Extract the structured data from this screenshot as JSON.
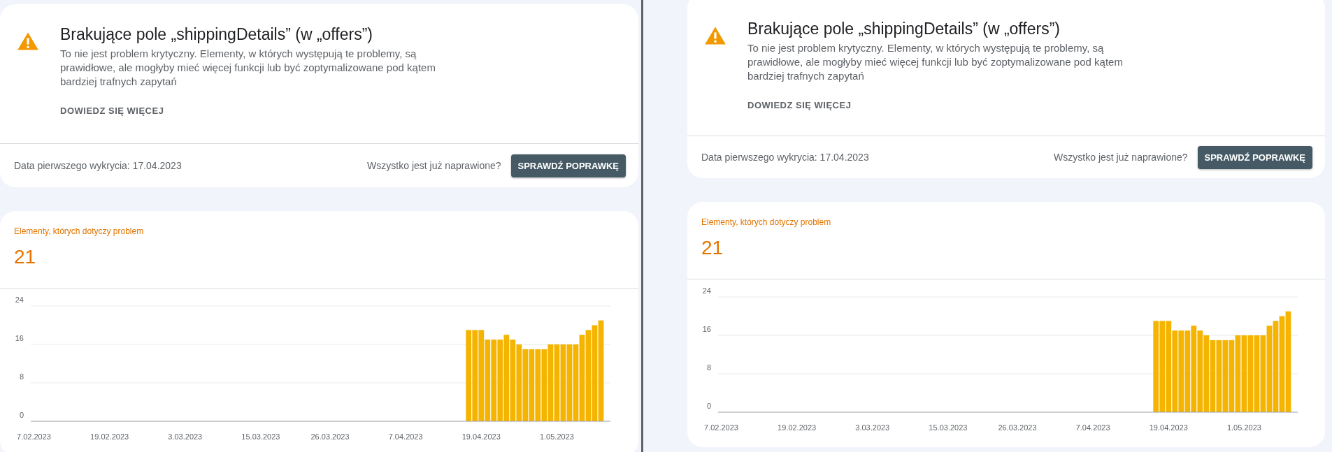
{
  "windows": [
    {
      "issue": {
        "title": "Brakujące pole „shippingDetails” (w „offers”)",
        "description": "To nie jest problem krytyczny. Elementy, w których występują te problemy, są prawidłowe, ale mogłyby mieć więcej funkcji lub być zoptymalizowane pod kątem bardziej trafnych zapytań",
        "learn_more": "DOWIEDZ SIĘ WIĘCEJ",
        "first_detected": "Data pierwszego wykrycia: 17.04.2023",
        "fixed_question": "Wszystko jest już naprawione?",
        "validate_button": "SPRAWDŹ POPRAWKĘ"
      },
      "affected": {
        "label": "Elementy, których dotyczy problem",
        "count": "21",
        "chart_data": {
          "type": "bar",
          "categories": [
            "7.02.2023",
            null,
            null,
            null,
            null,
            null,
            null,
            null,
            null,
            null,
            null,
            null,
            "19.02.2023",
            null,
            null,
            null,
            null,
            null,
            null,
            null,
            null,
            null,
            null,
            null,
            "3.03.2023",
            null,
            null,
            null,
            null,
            null,
            null,
            null,
            null,
            null,
            null,
            null,
            "15.03.2023",
            null,
            null,
            null,
            null,
            null,
            null,
            null,
            null,
            null,
            null,
            "26.03.2023",
            null,
            null,
            null,
            null,
            null,
            null,
            null,
            null,
            null,
            null,
            null,
            "7.04.2023",
            null,
            null,
            null,
            null,
            null,
            null,
            null,
            null,
            null,
            null,
            null,
            "19.04.2023",
            null,
            null,
            null,
            null,
            null,
            null,
            null,
            null,
            null,
            null,
            null,
            "1.05.2023",
            null,
            null,
            null,
            null,
            null,
            null,
            null,
            null
          ],
          "values": [
            null,
            null,
            null,
            null,
            null,
            null,
            null,
            null,
            null,
            null,
            null,
            null,
            null,
            null,
            null,
            null,
            null,
            null,
            null,
            null,
            null,
            null,
            null,
            null,
            null,
            null,
            null,
            null,
            null,
            null,
            null,
            null,
            null,
            null,
            null,
            null,
            null,
            null,
            null,
            null,
            null,
            null,
            null,
            null,
            null,
            null,
            null,
            null,
            null,
            null,
            null,
            null,
            null,
            null,
            null,
            null,
            null,
            null,
            null,
            null,
            null,
            null,
            null,
            null,
            null,
            null,
            null,
            null,
            null,
            19,
            19,
            19,
            17,
            17,
            17,
            18,
            17,
            16,
            15,
            15,
            15,
            15,
            16,
            16,
            16,
            16,
            16,
            18,
            19,
            20,
            21,
            null
          ],
          "ylim": [
            0,
            24
          ],
          "yticks": [
            0,
            8,
            16,
            24
          ]
        }
      }
    },
    {
      "issue": {
        "title": "Brakujące pole „shippingDetails” (w „offers”)",
        "description": "To nie jest problem krytyczny. Elementy, w których występują te problemy, są prawidłowe, ale mogłyby mieć więcej funkcji lub być zoptymalizowane pod kątem bardziej trafnych zapytań",
        "learn_more": "DOWIEDZ SIĘ WIĘCEJ",
        "first_detected": "Data pierwszego wykrycia: 17.04.2023",
        "fixed_question": "Wszystko jest już naprawione?",
        "validate_button": "SPRAWDŹ POPRAWKĘ"
      },
      "affected": {
        "label": "Elementy, których dotyczy problem",
        "count": "21",
        "chart_data": {
          "type": "bar",
          "categories": [
            "7.02.2023",
            null,
            null,
            null,
            null,
            null,
            null,
            null,
            null,
            null,
            null,
            null,
            "19.02.2023",
            null,
            null,
            null,
            null,
            null,
            null,
            null,
            null,
            null,
            null,
            null,
            "3.03.2023",
            null,
            null,
            null,
            null,
            null,
            null,
            null,
            null,
            null,
            null,
            null,
            "15.03.2023",
            null,
            null,
            null,
            null,
            null,
            null,
            null,
            null,
            null,
            null,
            "26.03.2023",
            null,
            null,
            null,
            null,
            null,
            null,
            null,
            null,
            null,
            null,
            null,
            "7.04.2023",
            null,
            null,
            null,
            null,
            null,
            null,
            null,
            null,
            null,
            null,
            null,
            "19.04.2023",
            null,
            null,
            null,
            null,
            null,
            null,
            null,
            null,
            null,
            null,
            null,
            "1.05.2023",
            null,
            null,
            null,
            null,
            null,
            null,
            null,
            null
          ],
          "values": [
            null,
            null,
            null,
            null,
            null,
            null,
            null,
            null,
            null,
            null,
            null,
            null,
            null,
            null,
            null,
            null,
            null,
            null,
            null,
            null,
            null,
            null,
            null,
            null,
            null,
            null,
            null,
            null,
            null,
            null,
            null,
            null,
            null,
            null,
            null,
            null,
            null,
            null,
            null,
            null,
            null,
            null,
            null,
            null,
            null,
            null,
            null,
            null,
            null,
            null,
            null,
            null,
            null,
            null,
            null,
            null,
            null,
            null,
            null,
            null,
            null,
            null,
            null,
            null,
            null,
            null,
            null,
            null,
            null,
            19,
            19,
            19,
            17,
            17,
            17,
            18,
            17,
            16,
            15,
            15,
            15,
            15,
            16,
            16,
            16,
            16,
            16,
            18,
            19,
            20,
            21,
            null
          ],
          "ylim": [
            0,
            24
          ],
          "yticks": [
            0,
            8,
            16,
            24
          ]
        }
      }
    }
  ]
}
